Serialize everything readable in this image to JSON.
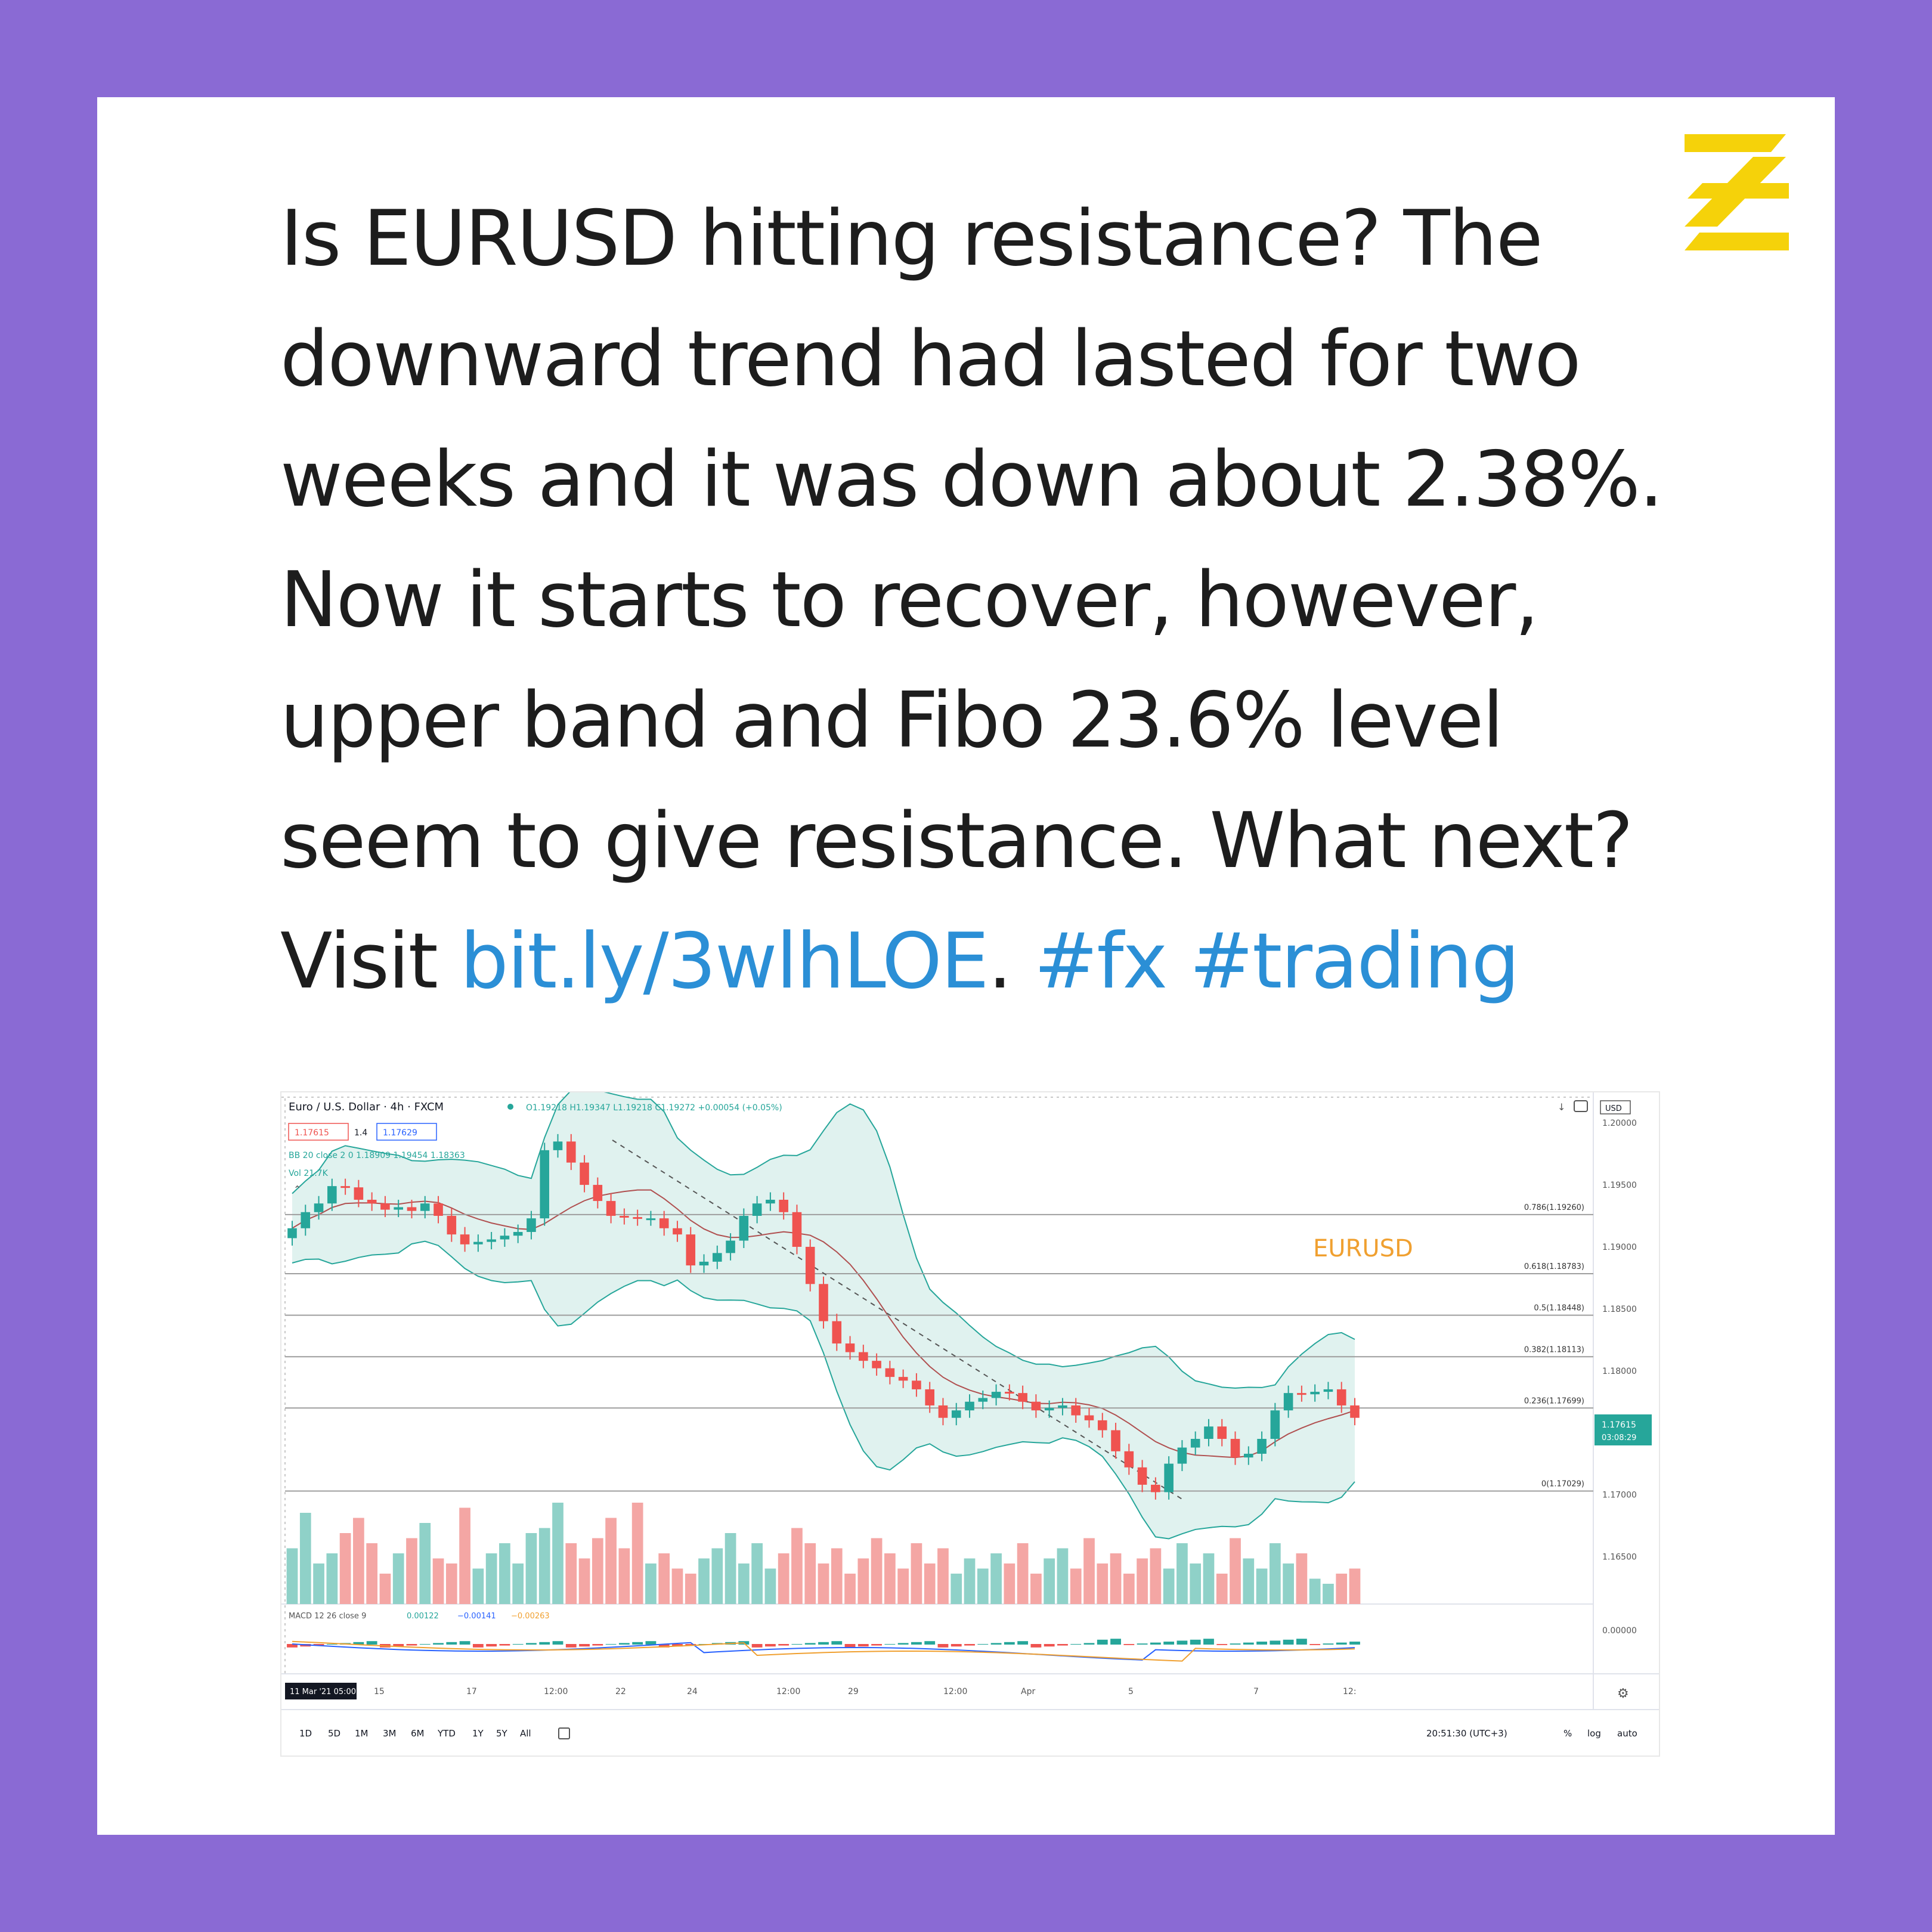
{
  "post": {
    "lines": [
      "Is EURUSD hitting resistance? The",
      "downward trend had lasted for two",
      "weeks and it was down about 2.38%.",
      "Now it starts to recover, however,",
      "upper band and Fibo 23.6% level",
      "seem to give resistance. What next?"
    ],
    "last_line_prefix": "Visit ",
    "link": "bit.ly/3wlhLOE",
    "link_suffix": ". ",
    "hashtag_1": "#fx",
    "hashtag_2": "#trading"
  },
  "colors": {
    "background": "#8a6ad4",
    "card": "#ffffff",
    "logo": "#f5d20a",
    "link": "#2b8fd6",
    "bull": "#26a69a",
    "bear": "#ef5350",
    "bollinger_fill": "#e0f2ef",
    "annotation": "#f0a030"
  },
  "chart_header": {
    "symbol": "Euro / U.S. Dollar · 4h · FXCM",
    "ohlc": "O1.19218 H1.19347 L1.19218 C1.19272 +0.00054 (+0.05%)",
    "bid": "1.17615",
    "spread": "1.4",
    "ask": "1.17629",
    "bb_legend": "BB 20 close 2 0  1.18909  1.19454  1.18363",
    "vol_legend": "Vol  21.7K",
    "macd_legend_label": "MACD 12 26 close 9",
    "macd_values": [
      "0.00122",
      "−0.00141",
      "−0.00263"
    ],
    "currency": "USD"
  },
  "chart_data": {
    "type": "candlestick",
    "title": "EURUSD",
    "timeframe": "4h",
    "x_tick_labels": [
      "11 Mar '21  05:00",
      "15",
      "17",
      "12:00",
      "22",
      "24",
      "12:00",
      "29",
      "12:00",
      "Apr",
      "5",
      "7",
      "12:"
    ],
    "y_tick_labels": [
      "1.20000",
      "1.19500",
      "1.19000",
      "1.18500",
      "1.18000",
      "1.17500",
      "1.17000",
      "1.16500"
    ],
    "ylim": [
      1.163,
      1.2015
    ],
    "last_price": "1.17615",
    "countdown": "03:08:29",
    "macd_tick": "0.00000",
    "annotation": "EURUSD",
    "fibonacci_levels": [
      {
        "label": "0.786(1.19260)",
        "value": 1.1926
      },
      {
        "label": "0.618(1.18783)",
        "value": 1.18783
      },
      {
        "label": "0.5(1.18448)",
        "value": 1.18448
      },
      {
        "label": "0.382(1.18113)",
        "value": 1.18113
      },
      {
        "label": "0.236(1.17699)",
        "value": 1.17699
      },
      {
        "label": "0(1.17029)",
        "value": 1.17029
      }
    ],
    "close_path": [
      1.1915,
      1.1928,
      1.1935,
      1.1949,
      1.1948,
      1.1938,
      1.1935,
      1.193,
      1.1932,
      1.1929,
      1.1935,
      1.1925,
      1.191,
      1.1902,
      1.1904,
      1.1906,
      1.1909,
      1.1912,
      1.1923,
      1.1978,
      1.1985,
      1.1968,
      1.195,
      1.1937,
      1.1925,
      1.1924,
      1.1923,
      1.1923,
      1.1915,
      1.191,
      1.1885,
      1.1888,
      1.1895,
      1.1905,
      1.1925,
      1.1935,
      1.1938,
      1.1928,
      1.19,
      1.187,
      1.184,
      1.1822,
      1.1815,
      1.1808,
      1.1802,
      1.1795,
      1.1792,
      1.1785,
      1.1772,
      1.1762,
      1.1768,
      1.1775,
      1.1778,
      1.1783,
      1.1782,
      1.1775,
      1.1768,
      1.177,
      1.1772,
      1.1764,
      1.176,
      1.1752,
      1.1735,
      1.1722,
      1.1708,
      1.1702,
      1.1725,
      1.1738,
      1.1745,
      1.1755,
      1.1745,
      1.173,
      1.1733,
      1.1745,
      1.1768,
      1.1782,
      1.1781,
      1.1783,
      1.1785,
      1.1772,
      1.1762
    ],
    "volume_path": [
      0.55,
      0.9,
      0.4,
      0.5,
      0.7,
      0.85,
      0.6,
      0.3,
      0.5,
      0.65,
      0.8,
      0.45,
      0.4,
      0.95,
      0.35,
      0.5,
      0.6,
      0.4,
      0.7,
      0.75,
      1.0,
      0.6,
      0.45,
      0.65,
      0.85,
      0.55,
      1.0,
      0.4,
      0.5,
      0.35,
      0.3,
      0.45,
      0.55,
      0.7,
      0.4,
      0.6,
      0.35,
      0.5,
      0.75,
      0.6,
      0.4,
      0.55,
      0.3,
      0.45,
      0.65,
      0.5,
      0.35,
      0.6,
      0.4,
      0.55,
      0.3,
      0.45,
      0.35,
      0.5,
      0.4,
      0.6,
      0.3,
      0.45,
      0.55,
      0.35,
      0.65,
      0.4,
      0.5,
      0.3,
      0.45,
      0.55,
      0.35,
      0.6,
      0.4,
      0.5,
      0.3,
      0.65,
      0.45,
      0.35,
      0.6,
      0.4,
      0.5,
      0.25,
      0.2,
      0.3,
      0.35
    ],
    "bottom_toolbar": {
      "ranges": [
        "1D",
        "5D",
        "1M",
        "3M",
        "6M",
        "YTD",
        "1Y",
        "5Y",
        "All"
      ],
      "time": "20:51:30 (UTC+3)",
      "right_options": [
        "%",
        "log",
        "auto"
      ]
    }
  }
}
